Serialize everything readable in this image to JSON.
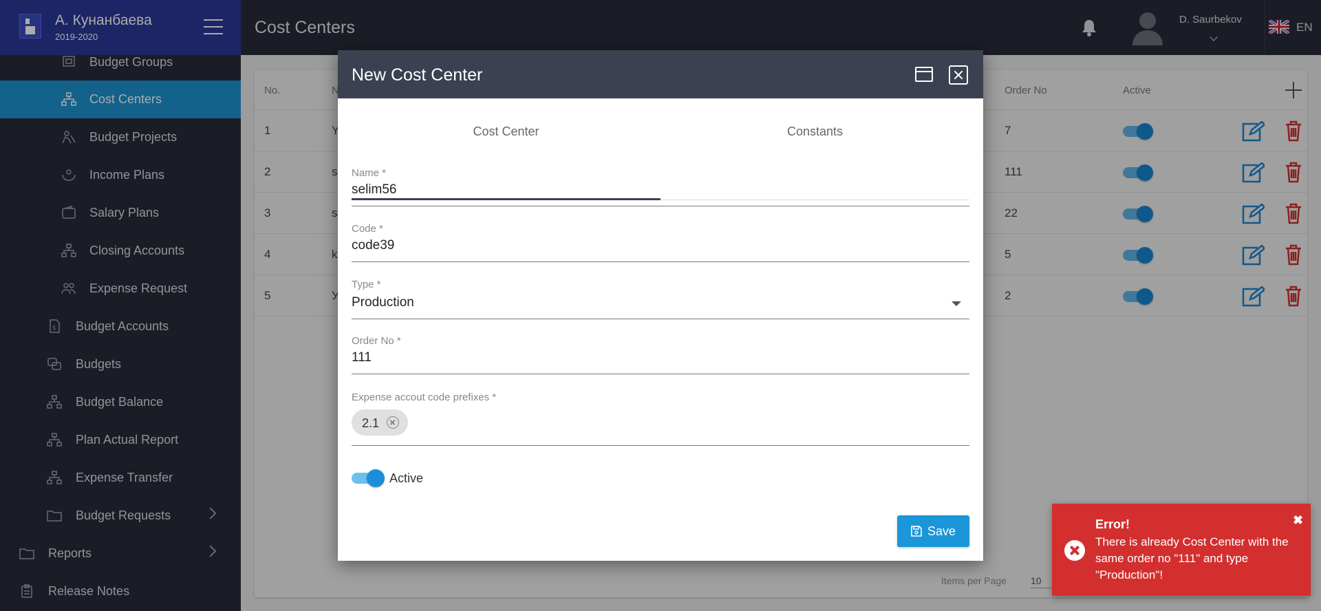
{
  "sidebar": {
    "brand_title": "А. Кунанбаева",
    "brand_subtitle": "2019-2020",
    "items": [
      {
        "label": "Budget Groups"
      },
      {
        "label": "Cost Centers"
      },
      {
        "label": "Budget Projects"
      },
      {
        "label": "Income Plans"
      },
      {
        "label": "Salary Plans"
      },
      {
        "label": "Closing Accounts"
      },
      {
        "label": "Expense Request"
      },
      {
        "label": "Budget Accounts"
      },
      {
        "label": "Budgets"
      },
      {
        "label": "Budget Balance"
      },
      {
        "label": "Plan Actual Report"
      },
      {
        "label": "Expense Transfer"
      },
      {
        "label": "Budget Requests"
      },
      {
        "label": "Reports"
      },
      {
        "label": "Release Notes"
      }
    ]
  },
  "header": {
    "title": "Cost Centers",
    "username": "D. Saurbekov",
    "language": "EN"
  },
  "table": {
    "columns": {
      "no": "No.",
      "name": "N",
      "order_no": "Order No",
      "active": "Active"
    },
    "rows": [
      {
        "no": "1",
        "name_partial": "Y",
        "order_no": "7",
        "active": true
      },
      {
        "no": "2",
        "name_partial": "s",
        "order_no": "111",
        "active": true
      },
      {
        "no": "3",
        "name_partial": "s",
        "order_no": "22",
        "active": true
      },
      {
        "no": "4",
        "name_partial": "k",
        "order_no": "5",
        "active": true
      },
      {
        "no": "5",
        "name_partial": "У",
        "order_no": "2",
        "active": true
      }
    ],
    "items_per_page_label": "Items per Page",
    "items_per_page_value": "10"
  },
  "modal": {
    "title": "New Cost Center",
    "tabs": [
      {
        "label": "Cost Center"
      },
      {
        "label": "Constants"
      }
    ],
    "fields": {
      "name_label": "Name *",
      "name_value": "selim56",
      "code_label": "Code *",
      "code_value": "code39",
      "type_label": "Type *",
      "type_value": "Production",
      "order_label": "Order No *",
      "order_value": "111",
      "prefix_label": "Expense accout code prefixes *",
      "prefix_chip": "2.1"
    },
    "active_label": "Active",
    "active_value": true,
    "save_label": "Save"
  },
  "toast": {
    "title": "Error!",
    "message": "There is already Cost Center with the same order no \"111\" and type \"Production\"!",
    "close": "✖"
  },
  "colors": {
    "sidebar_bg": "#272c38",
    "brand_bg": "#2b3899",
    "active_item": "#1d92d0",
    "modal_header": "#3b4150",
    "primary": "#1b96d8",
    "error": "#d32f2f",
    "delete_red": "#d32f2f"
  }
}
